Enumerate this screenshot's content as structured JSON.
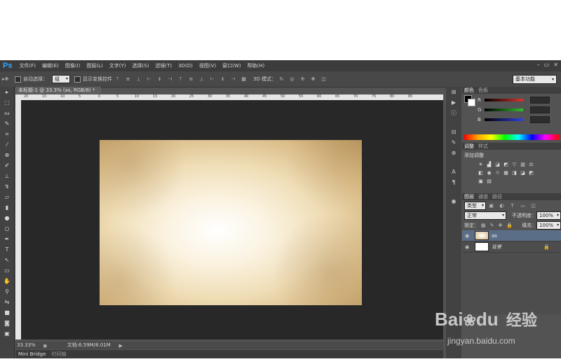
{
  "app": {
    "logo": "Ps"
  },
  "menu": [
    "文件(F)",
    "编辑(E)",
    "图像(I)",
    "图层(L)",
    "文字(Y)",
    "选择(S)",
    "滤镜(T)",
    "3D(D)",
    "视图(V)",
    "窗口(W)",
    "帮助(H)"
  ],
  "window_controls": [
    "–",
    "▭",
    "✕"
  ],
  "options_bar": {
    "auto_select_label": "自动选择：",
    "auto_select_value": "组",
    "show_transform_label": "显示变换控件",
    "mode_3d_label": "3D 模式：",
    "workspace": "基本功能"
  },
  "document": {
    "tab_title": "未标题-1 @ 33.3% (as, RGB/8) *",
    "ruler_ticks": [
      "20",
      "15",
      "10",
      "5",
      "0",
      "5",
      "10",
      "15",
      "20",
      "25",
      "30",
      "35",
      "40",
      "45",
      "50",
      "55",
      "60",
      "65",
      "70",
      "75",
      "80",
      "85"
    ],
    "zoom": "33.33%",
    "doc_info": "文档:6.59M/8.01M"
  },
  "bottom_tabs": [
    "Mini Bridge",
    "时间轴"
  ],
  "color_panel": {
    "tabs": [
      "颜色",
      "色板"
    ],
    "channels": [
      {
        "label": "R",
        "gradient_color": "#e03030"
      },
      {
        "label": "G",
        "gradient_color": "#30c030"
      },
      {
        "label": "B",
        "gradient_color": "#3040e0"
      }
    ]
  },
  "adjustments_panel": {
    "tabs": [
      "调整",
      "样式"
    ],
    "title": "添加调整"
  },
  "layers_panel": {
    "tabs": [
      "图层",
      "通道",
      "路径"
    ],
    "filter_kind": "类型",
    "blend_mode": "正常",
    "opacity_label": "不透明度：",
    "opacity_value": "100%",
    "lock_label": "锁定：",
    "fill_label": "填充：",
    "fill_value": "100%",
    "layers": [
      {
        "name": "as",
        "selected": true
      },
      {
        "name": "背景",
        "selected": false
      }
    ]
  },
  "watermark": {
    "brand": "Bai",
    "brand2": "du",
    "product": "经验",
    "url": "jingyan.baidu.com"
  }
}
